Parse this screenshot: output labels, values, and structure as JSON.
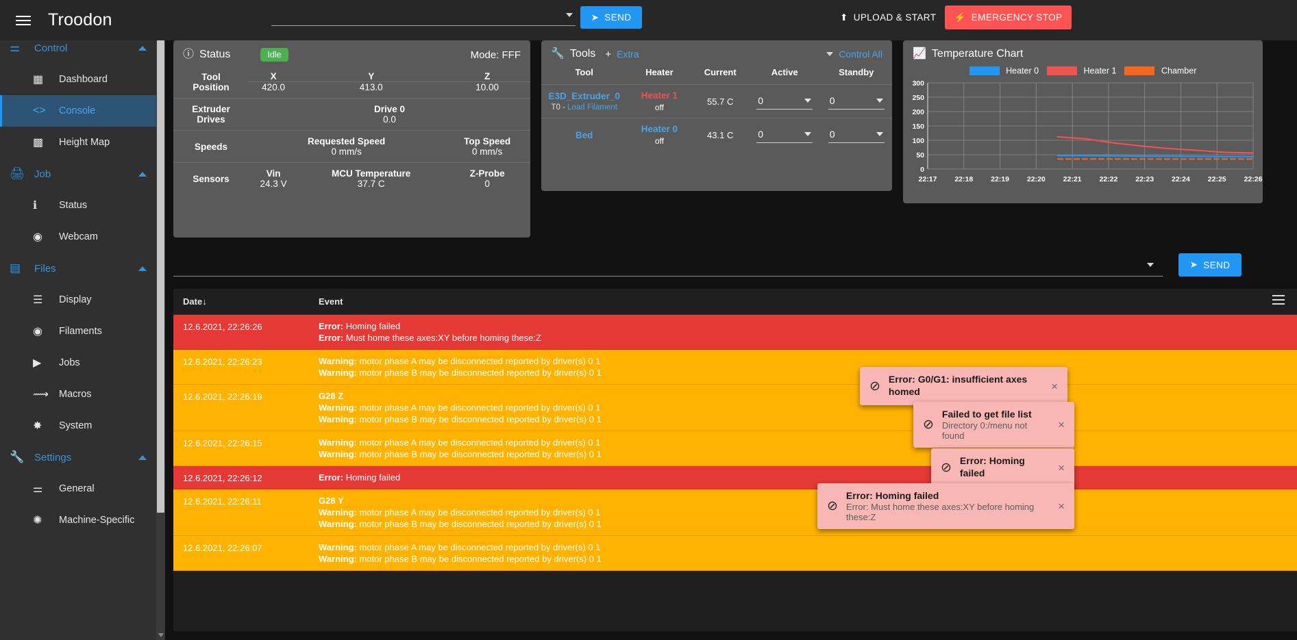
{
  "topbar": {
    "brand": "Troodon",
    "command_value": "",
    "command_placeholder": "",
    "send_label": "SEND",
    "upload_label": "UPLOAD & START",
    "estop_label": "EMERGENCY STOP"
  },
  "sidebar": {
    "groups": [
      {
        "label": "Control",
        "icon": "sliders-icon",
        "items": [
          {
            "label": "Dashboard",
            "icon": "dashboard-icon",
            "active": false
          },
          {
            "label": "Console",
            "icon": "code-icon",
            "active": true
          },
          {
            "label": "Height Map",
            "icon": "grid-icon",
            "active": false
          }
        ]
      },
      {
        "label": "Job",
        "icon": "printer-icon",
        "items": [
          {
            "label": "Status",
            "icon": "info-icon",
            "active": false
          },
          {
            "label": "Webcam",
            "icon": "webcam-icon",
            "active": false
          }
        ]
      },
      {
        "label": "Files",
        "icon": "sdcard-icon",
        "items": [
          {
            "label": "Display",
            "icon": "list-icon",
            "active": false
          },
          {
            "label": "Filaments",
            "icon": "circle-dot-icon",
            "active": false
          },
          {
            "label": "Jobs",
            "icon": "play-icon",
            "active": false
          },
          {
            "label": "Macros",
            "icon": "macro-icon",
            "active": false
          },
          {
            "label": "System",
            "icon": "gear-icon",
            "active": false
          }
        ]
      },
      {
        "label": "Settings",
        "icon": "wrench-icon",
        "items": [
          {
            "label": "General",
            "icon": "sliders-icon",
            "active": false
          },
          {
            "label": "Machine-Specific",
            "icon": "gears-icon",
            "active": false
          }
        ]
      }
    ]
  },
  "status_card": {
    "title": "Status",
    "badge": "Idle",
    "mode": "Mode: FFF",
    "rows": [
      {
        "label": "Tool Position",
        "cells": [
          {
            "header": "X",
            "value": "420.0"
          },
          {
            "header": "Y",
            "value": "413.0"
          },
          {
            "header": "Z",
            "value": "10.00"
          }
        ]
      },
      {
        "label": "Extruder Drives",
        "cells": [
          {
            "header": "Drive 0",
            "value": "0.0"
          }
        ]
      },
      {
        "label": "Speeds",
        "cells": [
          {
            "header": "Requested Speed",
            "value": "0 mm/s"
          },
          {
            "header": "Top Speed",
            "value": "0 mm/s"
          }
        ]
      },
      {
        "label": "Sensors",
        "cells": [
          {
            "header": "Vin",
            "value": "24.3 V"
          },
          {
            "header": "MCU Temperature",
            "value": "37.7 C"
          },
          {
            "header": "Z-Probe",
            "value": "0"
          }
        ]
      }
    ]
  },
  "tools_card": {
    "title": "Tools",
    "extra_label": "Extra",
    "plus_label": "+",
    "control_all_label": "Control All",
    "columns": [
      "Tool",
      "Heater",
      "Current",
      "Active",
      "Standby"
    ],
    "rows": [
      {
        "tool": "E3D_Extruder_0",
        "tool_sub_prefix": "T0 - ",
        "tool_sub_link": "Load Filament",
        "heater": "Heater 1",
        "heater_state": "off",
        "heater_color": "red",
        "current": "55.7 C",
        "active": "0",
        "standby": "0"
      },
      {
        "tool": "Bed",
        "tool_sub_prefix": "",
        "tool_sub_link": "",
        "heater": "Heater 0",
        "heater_state": "off",
        "heater_color": "blue",
        "current": "43.1 C",
        "active": "0",
        "standby": "0"
      }
    ]
  },
  "chart_data": {
    "type": "line",
    "title": "Temperature Chart",
    "xlabel": "",
    "ylabel": "",
    "ylim": [
      0,
      300
    ],
    "yticks": [
      0,
      50,
      100,
      150,
      200,
      250,
      300
    ],
    "x": [
      "22:17",
      "22:18",
      "22:19",
      "22:20",
      "22:21",
      "22:22",
      "22:23",
      "22:24",
      "22:25",
      "22:26"
    ],
    "grid": true,
    "legend_position": "top",
    "series": [
      {
        "name": "Heater 0",
        "color": "#2196f3",
        "style": "solid",
        "x": [
          "22:20.6",
          "22:21",
          "22:22",
          "22:23",
          "22:24",
          "22:25",
          "22:26",
          "22:26.6"
        ],
        "values": [
          47,
          47,
          46,
          45,
          45,
          44,
          43,
          43
        ]
      },
      {
        "name": "Heater 1",
        "color": "#ef5350",
        "style": "solid",
        "x": [
          "22:20.6",
          "22:21",
          "22:22",
          "22:23",
          "22:24",
          "22:25",
          "22:26",
          "22:26.6"
        ],
        "values": [
          112,
          105,
          91,
          80,
          71,
          65,
          58,
          56
        ]
      },
      {
        "name": "Chamber",
        "color": "#f4671c",
        "style": "dashed",
        "x": [
          "22:20.6",
          "22:21",
          "22:22",
          "22:23",
          "22:24",
          "22:25",
          "22:26",
          "22:26.6"
        ],
        "values": [
          35,
          35,
          35,
          35,
          35,
          35,
          35,
          35
        ]
      }
    ]
  },
  "console": {
    "input_value": "",
    "input_placeholder": "",
    "send_label": "SEND"
  },
  "event_table": {
    "col_date": "Date",
    "col_date_sort": "↓",
    "col_event": "Event",
    "rows": [
      {
        "date": "12.6.2021, 22:26:26",
        "type": "error",
        "lines": [
          {
            "tag": "Error:",
            "text": " Homing failed"
          },
          {
            "tag": "Error:",
            "text": " Must home these axes:XY before homing these:Z"
          }
        ]
      },
      {
        "date": "12.6.2021, 22:26:23",
        "type": "warning",
        "lines": [
          {
            "tag": "Warning:",
            "text": " motor phase A may be disconnected reported by driver(s) 0 1"
          },
          {
            "tag": "Warning:",
            "text": " motor phase B may be disconnected reported by driver(s) 0 1"
          }
        ]
      },
      {
        "date": "12.6.2021, 22:26:19",
        "type": "warning",
        "lines": [
          {
            "tag": "G28 Z",
            "text": ""
          },
          {
            "tag": "Warning:",
            "text": " motor phase A may be disconnected reported by driver(s) 0 1"
          },
          {
            "tag": "Warning:",
            "text": " motor phase B may be disconnected reported by driver(s) 0 1"
          }
        ]
      },
      {
        "date": "12.6.2021, 22:26:15",
        "type": "warning",
        "lines": [
          {
            "tag": "Warning:",
            "text": " motor phase A may be disconnected reported by driver(s) 0 1"
          },
          {
            "tag": "Warning:",
            "text": " motor phase B may be disconnected reported by driver(s) 0 1"
          }
        ]
      },
      {
        "date": "12.6.2021, 22:26:12",
        "type": "error",
        "lines": [
          {
            "tag": "Error:",
            "text": " Homing failed"
          }
        ]
      },
      {
        "date": "12.6.2021, 22:26:11",
        "type": "warning",
        "lines": [
          {
            "tag": "G28 Y",
            "text": ""
          },
          {
            "tag": "Warning:",
            "text": " motor phase A may be disconnected reported by driver(s) 0 1"
          },
          {
            "tag": "Warning:",
            "text": " motor phase B may be disconnected reported by driver(s) 0 1"
          }
        ]
      },
      {
        "date": "12.6.2021, 22:26:07",
        "type": "warning",
        "lines": [
          {
            "tag": "Warning:",
            "text": " motor phase A may be disconnected reported by driver(s) 0 1"
          },
          {
            "tag": "Warning:",
            "text": " motor phase B may be disconnected reported by driver(s) 0 1"
          }
        ]
      }
    ]
  },
  "toasts": [
    {
      "title": "Error: G0/G1: insufficient axes homed",
      "detail": "",
      "close": "×"
    },
    {
      "title": "Failed to get file list",
      "detail": "Directory 0:/menu not found",
      "close": "×"
    },
    {
      "title": "Error: Homing failed",
      "detail": "",
      "close": "×"
    },
    {
      "title": "Error: Homing failed",
      "detail": "Error: Must home these axes:XY before homing these:Z",
      "close": "×"
    }
  ],
  "colors": {
    "accent": "#2196f3",
    "danger": "#ff5252",
    "warning": "#ffb300",
    "error_row": "#e53935",
    "success": "#4caf50"
  }
}
